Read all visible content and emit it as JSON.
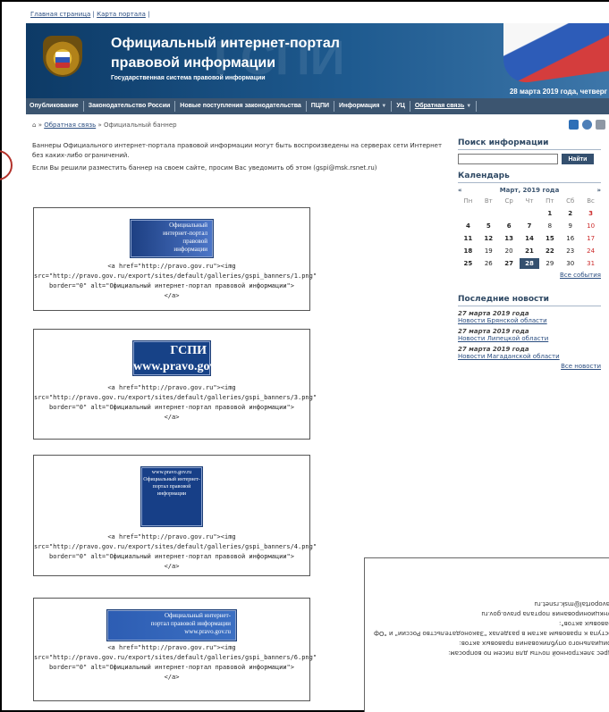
{
  "topbar": {
    "home": "Главная страница",
    "map": "Карта портала",
    "sep": "|"
  },
  "header": {
    "title_line1": "Официальный интернет-портал",
    "title_line2": "правовой информации",
    "subtitle": "Государственная система правовой информации",
    "watermark": "ГСПИ",
    "date": "28 марта 2019 года, четверг"
  },
  "nav": [
    "Опубликование",
    "Законодательство России",
    "Новые поступления законодательства",
    "ПЦПИ",
    "Информация",
    "УЦ",
    "Обратная связь"
  ],
  "breadcrumb": {
    "home_sep": "»",
    "link": "Обратная связь",
    "current": "Официальный баннер"
  },
  "content": {
    "p1": "Баннеры Официального интернет-портала правовой информации могут быть воспроизведены на серверах сети Интернет без каких-либо ограничений.",
    "p2": "Если Вы решили разместить баннер на своем сайте, просим Вас уведомить об этом (gspi@msk.rsnet.ru)"
  },
  "banners": [
    {
      "img_text": "Официальный интернет-портал правовой информации",
      "line1": "<a href=\"http://pravo.gov.ru\"><img",
      "line2": "src=\"http://pravo.gov.ru/export/sites/default/galleries/gspi_banners/1.png\"",
      "line3": "border=\"0\" alt=\"Официальный интернет-портал правовой информации\">",
      "line4": "</a>"
    },
    {
      "img_text": "ГСПИ www.pravo.gov.ru",
      "line1": "<a href=\"http://pravo.gov.ru\"><img",
      "line2": "src=\"http://pravo.gov.ru/export/sites/default/galleries/gspi_banners/3.png\"",
      "line3": "border=\"0\" alt=\"Официальный интернет-портал правовой информации\">",
      "line4": "</a>"
    },
    {
      "img_text": "www.pravo.gov.ru Официальный интернет-портал правовой информации",
      "line1": "<a href=\"http://pravo.gov.ru\"><img",
      "line2": "src=\"http://pravo.gov.ru/export/sites/default/galleries/gspi_banners/4.png\"",
      "line3": "border=\"0\" alt=\"Официальный интернет-портал правовой информации\">",
      "line4": "</a>"
    },
    {
      "img_text": "Официальный интернет-портал правовой информации www.pravo.gov.ru",
      "line1": "<a href=\"http://pravo.gov.ru\"><img",
      "line2": "src=\"http://pravo.gov.ru/export/sites/default/galleries/gspi_banners/6.png\"",
      "line3": "border=\"0\" alt=\"Официальный интернет-портал правовой информации\">",
      "line4": "</a>"
    }
  ],
  "sidebar": {
    "search_title": "Поиск информации",
    "search_button": "Найти",
    "calendar_title": "Календарь",
    "month": "Март, 2019 года",
    "prev": "«",
    "next": "»",
    "weekdays": [
      "Пн",
      "Вт",
      "Ср",
      "Чт",
      "Пт",
      "Сб",
      "Вс"
    ],
    "all_events": "Все события",
    "news_title": "Последние новости",
    "news": [
      {
        "date": "27 марта 2019 года",
        "title": "Новости Брянской области"
      },
      {
        "date": "27 марта 2019 года",
        "title": "Новости Липецкой области"
      },
      {
        "date": "27 марта 2019 года",
        "title": "Новости Магаданской области"
      }
    ],
    "all_news": "Все новости"
  },
  "overlay": {
    "lines": [
      "Адрес электронной почты для писем по вопросам:",
      "официального опубликования правовых актов:",
      "доступа к правовым актам в разделах \"Законодательство России\" и \"Оф",
      "правовых актов\":",
      "функционирования портала pravo.gov.ru",
      "",
      "pravoportal@msk.rsnet.ru"
    ]
  },
  "colors": {
    "header": "#1e5a8f",
    "nav": "#3c5570",
    "accent": "#34506f",
    "weekend": "#cc2b2b"
  }
}
